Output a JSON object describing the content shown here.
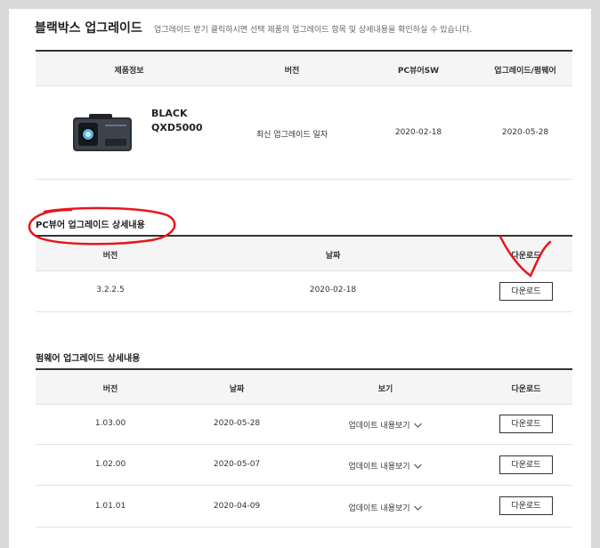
{
  "header": {
    "title": "블랙박스 업그레이드",
    "description": "업그레이드 받기 클릭하시면 선택 제품의 업그레이드 항목 및 상세내용을 확인하실 수 있습니다."
  },
  "product_table": {
    "headers": [
      "제품정보",
      "버전",
      "PC뷰어SW",
      "업그레이드/펌웨어"
    ],
    "product_line1": "BLACK",
    "product_line2": "QXD5000",
    "version": "최신 업그레이드 일자",
    "pc_viewer_sw": "2020-02-18",
    "firmware": "2020-05-28"
  },
  "pc_viewer": {
    "title": "PC뷰어 업그레이드 상세내용",
    "headers": [
      "버전",
      "날짜",
      "다운로드"
    ],
    "rows": [
      {
        "version": "3.2.2.5",
        "date": "2020-02-18",
        "download": "다운로드"
      }
    ]
  },
  "firmware": {
    "title": "펌웨어 업그레이드 상세내용",
    "headers": [
      "버전",
      "날짜",
      "보기",
      "다운로드"
    ],
    "rows": [
      {
        "version": "1.03.00",
        "date": "2020-05-28",
        "view": "업데이트 내용보기",
        "download": "다운로드"
      },
      {
        "version": "1.02.00",
        "date": "2020-05-07",
        "view": "업데이트 내용보기",
        "download": "다운로드"
      },
      {
        "version": "1.01.01",
        "date": "2020-04-09",
        "view": "업데이트 내용보기",
        "download": "다운로드"
      }
    ]
  },
  "colors": {
    "annotation": "#e8141c",
    "border_dark": "#333333",
    "header_bg": "#f5f5f5"
  },
  "icons": {
    "expand": "chevron-down-icon"
  }
}
